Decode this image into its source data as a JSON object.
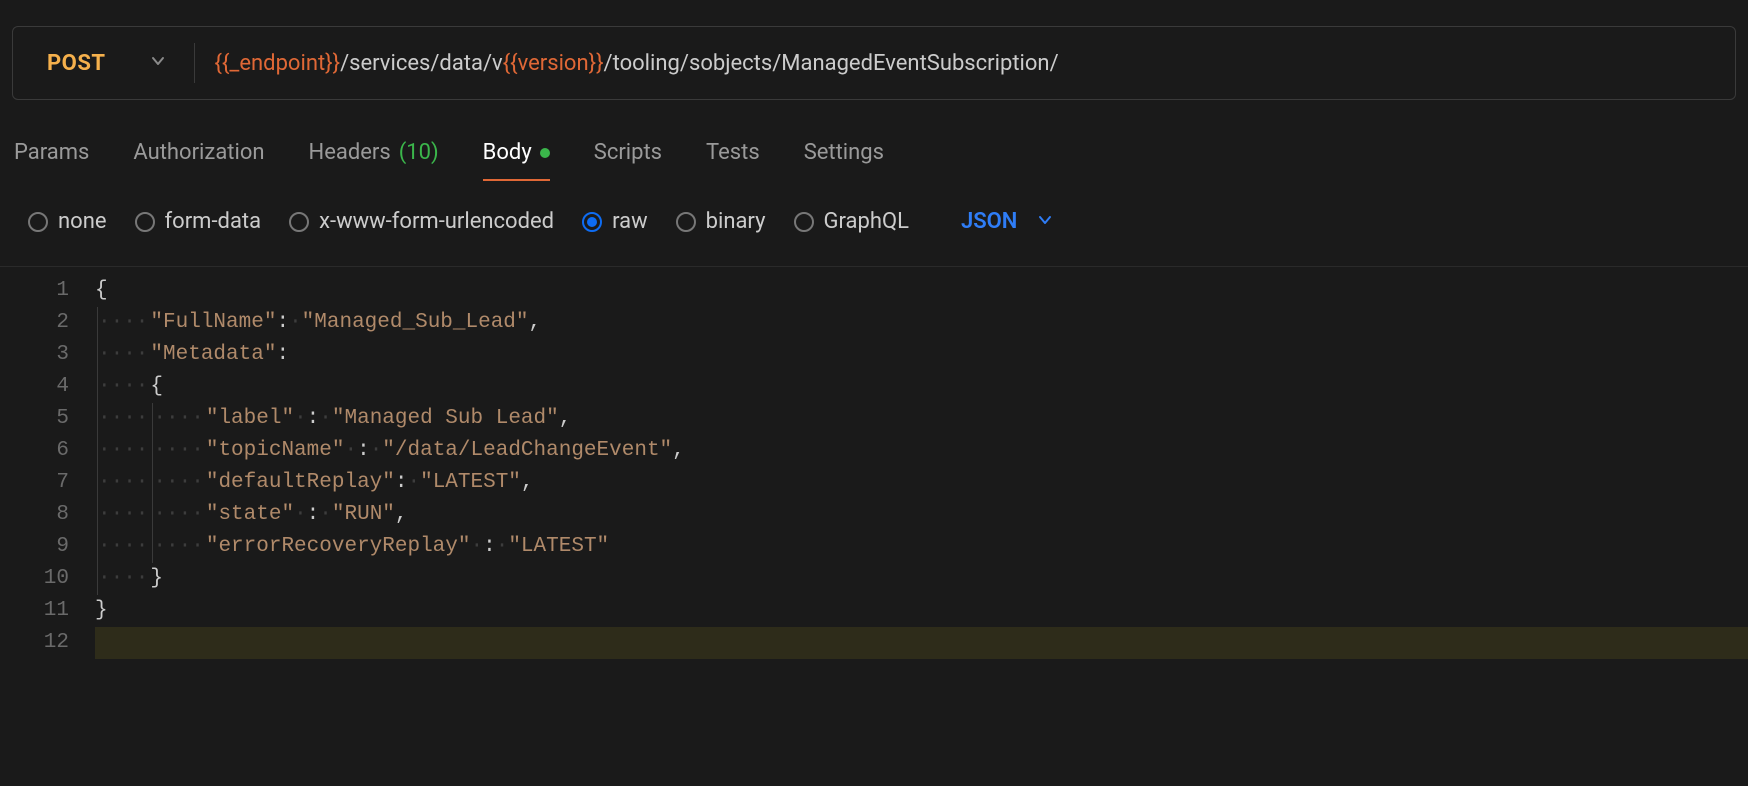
{
  "request": {
    "method": "POST",
    "url_parts": [
      {
        "kind": "var",
        "text": "{{_endpoint}}"
      },
      {
        "kind": "txt",
        "text": "/services/data/v"
      },
      {
        "kind": "var",
        "text": "{{version}}"
      },
      {
        "kind": "txt",
        "text": "/tooling/sobjects/ManagedEventSubscription/"
      }
    ]
  },
  "tabs": {
    "params": "Params",
    "authorization": "Authorization",
    "headers_label": "Headers",
    "headers_count": "(10)",
    "body": "Body",
    "scripts": "Scripts",
    "tests": "Tests",
    "settings": "Settings"
  },
  "body_types": {
    "none": "none",
    "form_data": "form-data",
    "urlencoded": "x-www-form-urlencoded",
    "raw": "raw",
    "binary": "binary",
    "graphql": "GraphQL"
  },
  "body_format": "JSON",
  "editor": {
    "lines": [
      [
        {
          "indent": 0,
          "t": "punc",
          "v": "{"
        }
      ],
      [
        {
          "indent": 1,
          "t": "key",
          "v": "\"FullName\""
        },
        {
          "t": "punc",
          "v": ":"
        },
        {
          "t": "sp"
        },
        {
          "t": "str",
          "v": "\"Managed_Sub_Lead\""
        },
        {
          "t": "punc",
          "v": ","
        }
      ],
      [
        {
          "indent": 1,
          "t": "key",
          "v": "\"Metadata\""
        },
        {
          "t": "punc",
          "v": ":"
        }
      ],
      [
        {
          "indent": 1,
          "t": "punc",
          "v": "{"
        }
      ],
      [
        {
          "indent": 2,
          "t": "key",
          "v": "\"label\""
        },
        {
          "t": "sp"
        },
        {
          "t": "punc",
          "v": ":"
        },
        {
          "t": "sp"
        },
        {
          "t": "str",
          "v": "\"Managed Sub Lead\""
        },
        {
          "t": "punc",
          "v": ","
        }
      ],
      [
        {
          "indent": 2,
          "t": "key",
          "v": "\"topicName\""
        },
        {
          "t": "sp"
        },
        {
          "t": "punc",
          "v": ":"
        },
        {
          "t": "sp"
        },
        {
          "t": "str",
          "v": "\"/data/LeadChangeEvent\""
        },
        {
          "t": "punc",
          "v": ","
        }
      ],
      [
        {
          "indent": 2,
          "t": "key",
          "v": "\"defaultReplay\""
        },
        {
          "t": "punc",
          "v": ":"
        },
        {
          "t": "sp"
        },
        {
          "t": "str",
          "v": "\"LATEST\""
        },
        {
          "t": "punc",
          "v": ","
        }
      ],
      [
        {
          "indent": 2,
          "t": "key",
          "v": "\"state\""
        },
        {
          "t": "sp"
        },
        {
          "t": "punc",
          "v": ":"
        },
        {
          "t": "sp"
        },
        {
          "t": "str",
          "v": "\"RUN\""
        },
        {
          "t": "punc",
          "v": ","
        }
      ],
      [
        {
          "indent": 2,
          "t": "key",
          "v": "\"errorRecoveryReplay\""
        },
        {
          "t": "sp"
        },
        {
          "t": "punc",
          "v": ":"
        },
        {
          "t": "sp"
        },
        {
          "t": "str",
          "v": "\"LATEST\""
        }
      ],
      [
        {
          "indent": 1,
          "t": "punc",
          "v": "}"
        }
      ],
      [
        {
          "indent": 0,
          "t": "punc",
          "v": "}"
        }
      ],
      []
    ],
    "line_count": 12,
    "current_line": 12
  }
}
